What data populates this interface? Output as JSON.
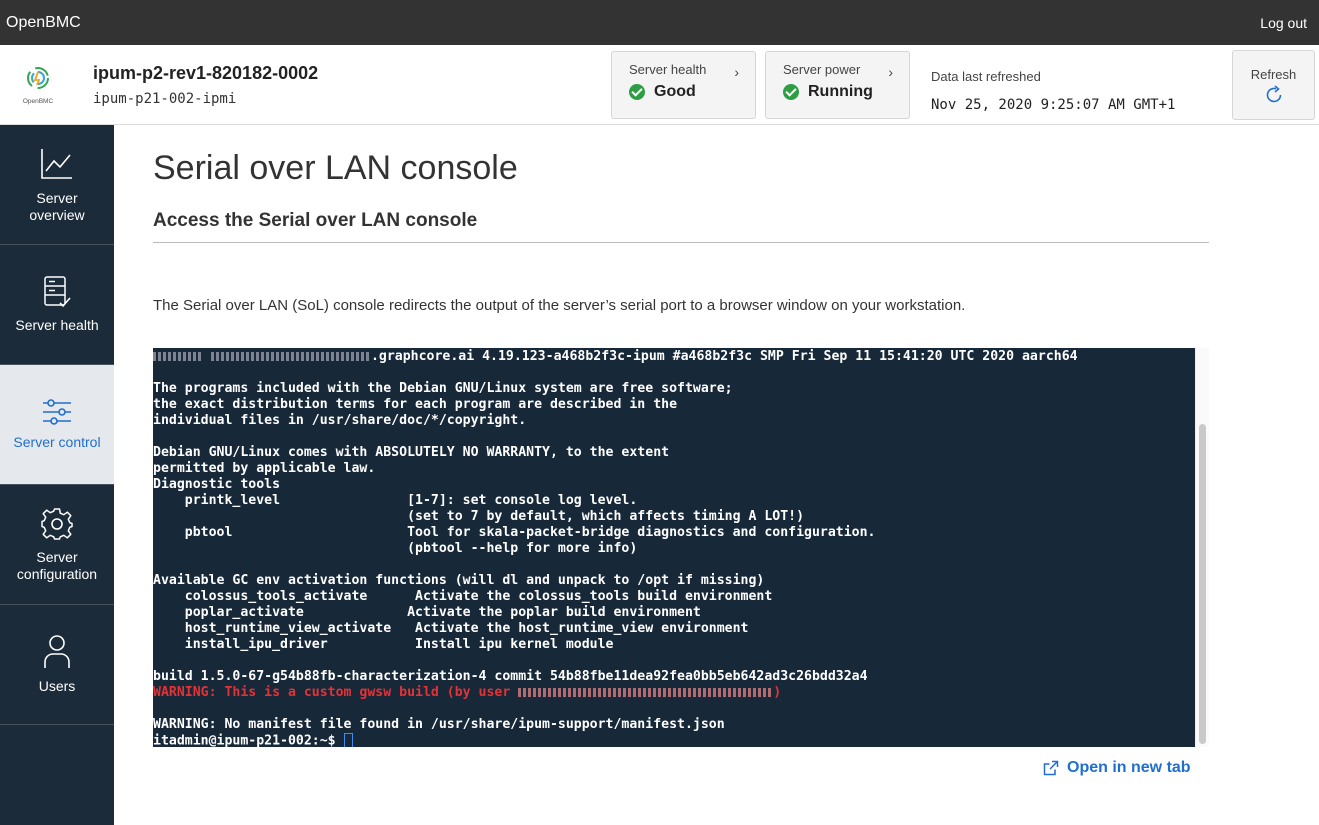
{
  "topbar": {
    "brand": "OpenBMC",
    "logout": "Log out"
  },
  "header": {
    "logo_text": "OpenBMC",
    "host_name": "ipum-p2-rev1-820182-0002",
    "host_ip": "ipum-p21-002-ipmi",
    "server_health": {
      "label": "Server health",
      "value": "Good"
    },
    "server_power": {
      "label": "Server power",
      "value": "Running"
    },
    "refreshed_label": "Data last refreshed",
    "refreshed_value": "Nov 25, 2020 9:25:07 AM GMT+1",
    "refresh_label": "Refresh"
  },
  "sidebar": {
    "items": [
      {
        "label1": "Server",
        "label2": "overview",
        "icon": "chart-icon"
      },
      {
        "label1": "Server health",
        "label2": "",
        "icon": "server-health-icon"
      },
      {
        "label1": "Server control",
        "label2": "",
        "icon": "sliders-icon",
        "active": true
      },
      {
        "label1": "Server",
        "label2": "configuration",
        "icon": "gear-icon"
      },
      {
        "label1": "Users",
        "label2": "",
        "icon": "user-icon"
      }
    ]
  },
  "main": {
    "title": "Serial over LAN console",
    "section_title": "Access the Serial over LAN console",
    "description": "The Serial over LAN (SoL) console redirects the output of the server’s serial port to a browser window on your workstation.",
    "open_new_tab": "Open in new tab"
  },
  "terminal": {
    "line0_suffix": ".graphcore.ai 4.19.123-a468b2f3c-ipum #a468b2f3c SMP Fri Sep 11 15:41:20 UTC 2020 aarch64",
    "line2": "The programs included with the Debian GNU/Linux system are free software;",
    "line3": "the exact distribution terms for each program are described in the",
    "line4": "individual files in /usr/share/doc/*/copyright.",
    "line6": "Debian GNU/Linux comes with ABSOLUTELY NO WARRANTY, to the extent",
    "line7": "permitted by applicable law.",
    "line8": "Diagnostic tools",
    "line9": "    printk_level                [1-7]: set console log level.",
    "line10": "                                (set to 7 by default, which affects timing A LOT!)",
    "line11": "    pbtool                      Tool for skala-packet-bridge diagnostics and configuration.",
    "line12": "                                (pbtool --help for more info)",
    "line14": "Available GC env activation functions (will dl and unpack to /opt if missing)",
    "line15": "    colossus_tools_activate      Activate the colossus_tools build environment",
    "line16": "    poplar_activate             Activate the poplar build environment",
    "line17": "    host_runtime_view_activate   Activate the host_runtime_view environment",
    "line18": "    install_ipu_driver           Install ipu kernel module",
    "line20": "build 1.5.0-67-g54b88fb-characterization-4 commit 54b88fbe11dea92fea0bb5eb642ad3c26bdd32a4",
    "line21_prefix": "WARNING: This is a custom gwsw build (by user ",
    "line21_suffix": ")",
    "line23": "WARNING: No manifest file found in /usr/share/ipum-support/manifest.json",
    "line24": "itadmin@ipum-p21-002:~$ "
  },
  "colors": {
    "topbar": "#333333",
    "sidebar": "#1c2b3a",
    "terminal_bg": "#172839",
    "accent": "#1f6fcf",
    "good": "#2f9d45",
    "warning": "#e63236"
  }
}
